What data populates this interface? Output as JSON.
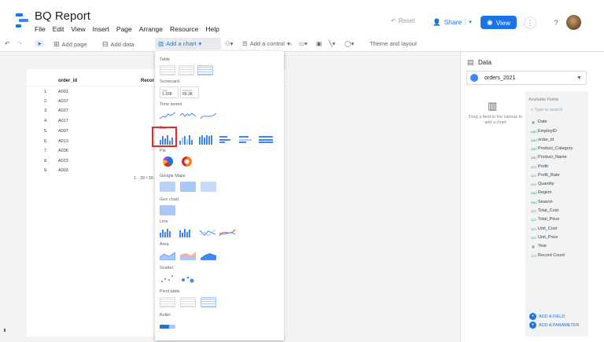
{
  "app": {
    "title": "BQ Report",
    "menus": [
      "File",
      "Edit",
      "View",
      "Insert",
      "Page",
      "Arrange",
      "Resource",
      "Help"
    ]
  },
  "header": {
    "reset": "Reset",
    "share": "Share",
    "view": "View"
  },
  "toolbar": {
    "add_page": "Add page",
    "add_data": "Add data",
    "add_chart": "Add a chart",
    "add_control": "Add a control",
    "theme_layout": "Theme and layout"
  },
  "table": {
    "header_id": "order_id",
    "header_rec": "Recor",
    "rows": [
      {
        "n": "1.",
        "id": "A001"
      },
      {
        "n": "2.",
        "id": "A037"
      },
      {
        "n": "3.",
        "id": "A027"
      },
      {
        "n": "4.",
        "id": "A017"
      },
      {
        "n": "5.",
        "id": "A007"
      },
      {
        "n": "6.",
        "id": "A013"
      },
      {
        "n": "7.",
        "id": "A036"
      },
      {
        "n": "8.",
        "id": "A023"
      },
      {
        "n": "9.",
        "id": "A003"
      }
    ],
    "pager": "1 - 39 / 39"
  },
  "chart_menu": {
    "sections": {
      "table": "Table",
      "scorecard": "Scorecard",
      "time_series": "Time series",
      "bar": "Bar",
      "pie": "Pie",
      "google_maps": "Google Maps",
      "geo_chart": "Geo chart",
      "line": "Line",
      "area": "Area",
      "scatter": "Scatter",
      "pivot": "Pivot table",
      "bullet": "Bullet"
    },
    "scorecard_1_label": "Total",
    "scorecard_1_value": "1,168",
    "scorecard_2_label": "Sessions",
    "scorecard_2_value": "69.3K"
  },
  "data_panel": {
    "title": "Data",
    "source": "orders_2021",
    "drop_hint": "Drag a field to the canvas to add a chart",
    "available": "Available Fields",
    "search": "Type to search",
    "fields": [
      "Date",
      "EmployID",
      "order_id",
      "Product_Category",
      "Product_Name",
      "Profit",
      "Profit_Rate",
      "Quantity",
      "Region",
      "Season",
      "Total_Cost",
      "Total_Price",
      "Unit_Cost",
      "Unit_Price",
      "Year",
      "Record Count"
    ],
    "add_field": "ADD A FIELD",
    "add_param": "ADD A PARAMETER"
  },
  "colors": {
    "accent": "#1a73e8",
    "highlight": "#d93025"
  }
}
